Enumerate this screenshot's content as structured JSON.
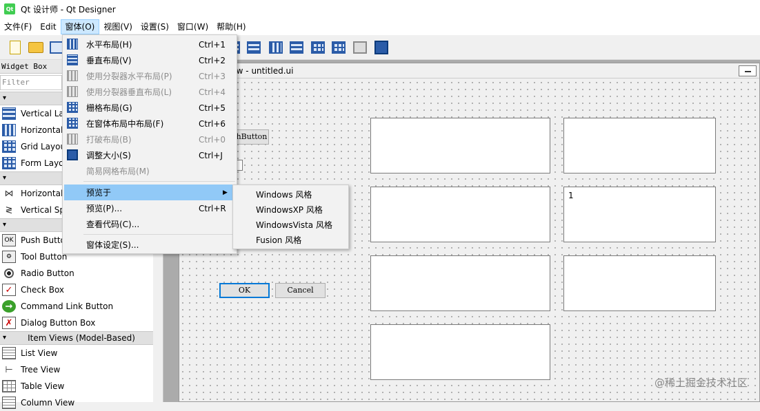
{
  "window": {
    "title": "Qt 设计师 - Qt Designer",
    "icon": "qt-logo-icon",
    "icon_text": "Qt"
  },
  "menubar": [
    {
      "label": "文件(F)"
    },
    {
      "label": "Edit"
    },
    {
      "label": "窗体(O)",
      "active": true
    },
    {
      "label": "视图(V)"
    },
    {
      "label": "设置(S)"
    },
    {
      "label": "窗口(W)"
    },
    {
      "label": "帮助(H)"
    }
  ],
  "widget_box": {
    "title": "Widget Box",
    "filter_placeholder": "Filter",
    "layouts": [
      "Vertical La",
      "Horizontal",
      "Grid Layou",
      "Form Layo"
    ],
    "spacers": [
      "Horizontal",
      "Vertical Sp"
    ],
    "buttons": [
      "Push Butto",
      "Tool Button",
      "Radio Button",
      "Check Box",
      "Command Link Button",
      "Dialog Button Box"
    ],
    "item_views_category": "Item Views (Model-Based)",
    "item_views": [
      "List View",
      "Tree View",
      "Table View",
      "Column View"
    ]
  },
  "form": {
    "title": "low - untitled.ui",
    "partial_button_label": "hButton",
    "textbox_value": "1",
    "ok_label": "OK",
    "cancel_label": "Cancel"
  },
  "form_menu": {
    "items": [
      {
        "label": "水平布局(H)",
        "shortcut": "Ctrl+1",
        "icon": "horizontal-layout-icon",
        "enabled": true
      },
      {
        "label": "垂直布局(V)",
        "shortcut": "Ctrl+2",
        "icon": "vertical-layout-icon",
        "enabled": true
      },
      {
        "label": "使用分裂器水平布局(P)",
        "shortcut": "Ctrl+3",
        "icon": "horizontal-splitter-icon",
        "enabled": false
      },
      {
        "label": "使用分裂器垂直布局(L)",
        "shortcut": "Ctrl+4",
        "icon": "vertical-splitter-icon",
        "enabled": false
      },
      {
        "label": "栅格布局(G)",
        "shortcut": "Ctrl+5",
        "icon": "grid-layout-icon",
        "enabled": true
      },
      {
        "label": "在窗体布局中布局(F)",
        "shortcut": "Ctrl+6",
        "icon": "form-layout-icon",
        "enabled": true
      },
      {
        "label": "打破布局(B)",
        "shortcut": "Ctrl+0",
        "icon": "break-layout-icon",
        "enabled": false
      },
      {
        "label": "调整大小(S)",
        "shortcut": "Ctrl+J",
        "icon": "adjust-size-icon",
        "enabled": true
      },
      {
        "label": "简易网格布局(M)",
        "shortcut": "",
        "icon": "",
        "enabled": false
      },
      {
        "label": "预览于",
        "shortcut": "",
        "icon": "",
        "enabled": true,
        "submenu": true
      },
      {
        "label": "预览(P)...",
        "shortcut": "Ctrl+R",
        "icon": "",
        "enabled": true
      },
      {
        "label": "查看代码(C)...",
        "shortcut": "",
        "icon": "",
        "enabled": true
      },
      {
        "label": "窗体设定(S)...",
        "shortcut": "",
        "icon": "",
        "enabled": true
      }
    ]
  },
  "preview_submenu": [
    "Windows 风格",
    "WindowsXP 风格",
    "WindowsVista 风格",
    "Fusion 风格"
  ],
  "watermark": "@稀土掘金技术社区",
  "colors": {
    "menu_highlight": "#91c9f7",
    "menubar_active": "#cce8ff",
    "layout_icon_blue": "#2b5ca8"
  }
}
